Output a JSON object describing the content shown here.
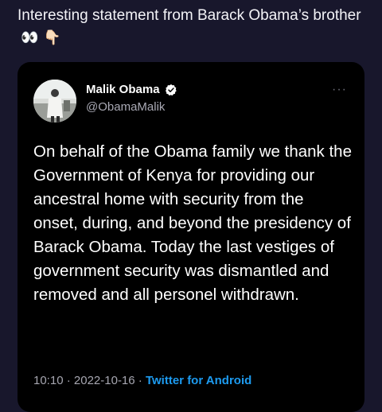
{
  "post": {
    "caption": "Interesting statement from Barack Obama’s brother",
    "caption_emoji": "👀 👇🏻"
  },
  "tweet": {
    "name": "Malik Obama",
    "handle": "@ObamaMalik",
    "more_label": "···",
    "body": "On behalf of the Obama family we thank the Government of Kenya for providing our ancestral home with security from the onset, during, and beyond the presidency of Barack Obama. Today the last vestiges of government security was dismantled and removed and all personel withdrawn.",
    "time": "10:10",
    "date": "2022-10-16",
    "separator": " · ",
    "source": "Twitter for Android"
  },
  "icons": {
    "verified": "verified-badge-icon",
    "more": "more-options-icon"
  },
  "colors": {
    "background": "#18172c",
    "card": "#000000",
    "link": "#1d9bf0",
    "secondary_text": "#a9a9b4"
  }
}
